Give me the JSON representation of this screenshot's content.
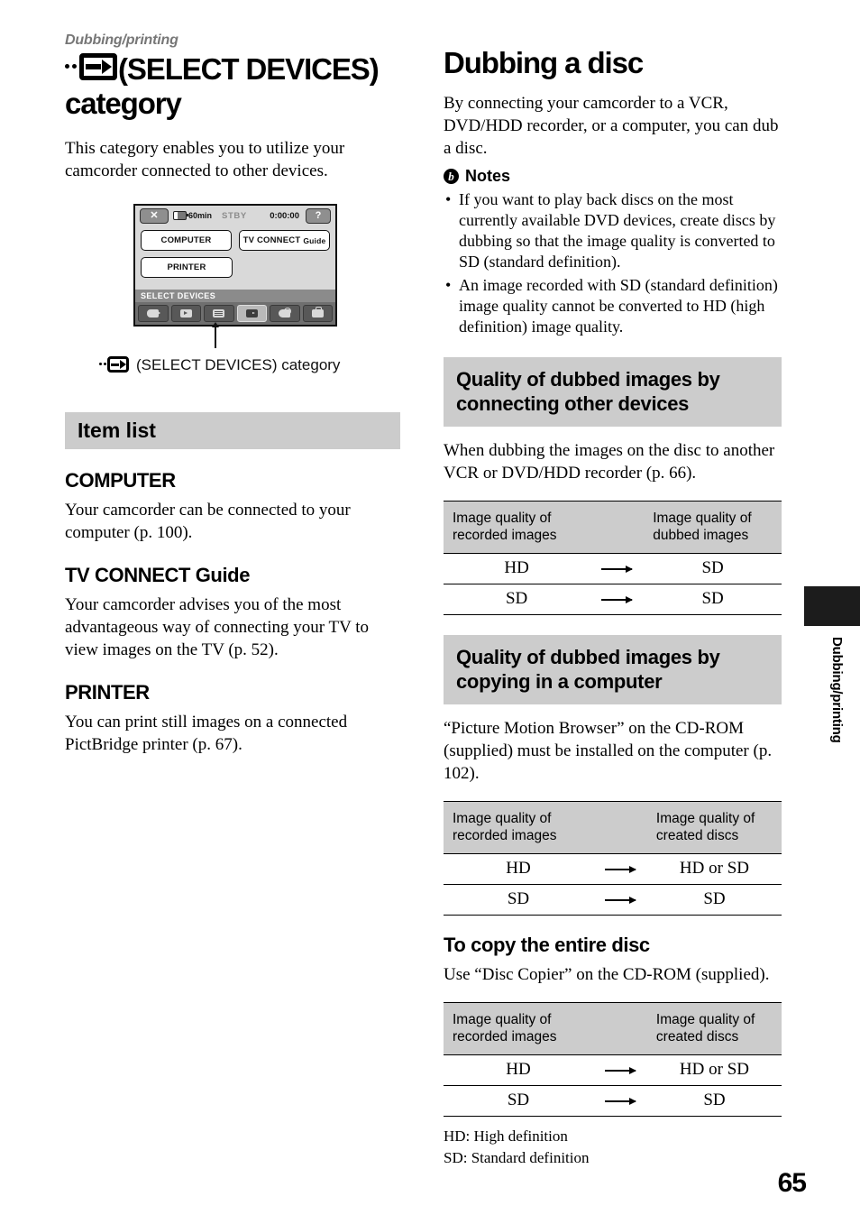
{
  "running_head": "Dubbing/printing",
  "left": {
    "title_text": "(SELECT DEVICES) category",
    "title_icon": "select-devices-icon",
    "intro": "This category enables you to utilize your camcorder connected to other devices.",
    "lcd": {
      "status": {
        "close_label": "✕",
        "battery_label": "60min",
        "mode_label": "STBY",
        "timecode": "0:00:00",
        "help_label": "?"
      },
      "items": [
        {
          "label": "COMPUTER"
        },
        {
          "label": "TV CONNECT",
          "sub": "Guide"
        },
        {
          "label": "PRINTER"
        }
      ],
      "category_label": "SELECT DEVICES",
      "tabs": [
        {
          "name": "camera-tab",
          "glyph": "cam",
          "active": false
        },
        {
          "name": "view-images-tab",
          "glyph": "play",
          "active": false
        },
        {
          "name": "others-tab",
          "glyph": "grid",
          "active": false
        },
        {
          "name": "select-devices-tab",
          "glyph": "dev",
          "active": true
        },
        {
          "name": "edit-tab",
          "glyph": "edit",
          "active": false
        },
        {
          "name": "manage-media-tab",
          "glyph": "tool",
          "active": false
        }
      ]
    },
    "lcd_caption": "(SELECT DEVICES) category",
    "item_list_heading": "Item list",
    "items": [
      {
        "heading": "COMPUTER",
        "body": "Your camcorder can be connected to your computer (p. 100)."
      },
      {
        "heading": "TV CONNECT Guide",
        "body": "Your camcorder advises you of the most advantageous way of connecting your TV to view images on the TV (p. 52)."
      },
      {
        "heading": "PRINTER",
        "body": "You can print still images on a connected PictBridge printer (p. 67)."
      }
    ]
  },
  "right": {
    "title": "Dubbing a disc",
    "intro": "By connecting your camcorder to a VCR, DVD/HDD recorder, or a computer, you can dub a disc.",
    "notes_heading": "Notes",
    "notes_icon_glyph": "b",
    "notes": [
      "If you want to play back discs on the most currently available DVD devices, create discs by dubbing so that the image quality is converted to SD (standard definition).",
      "An image recorded with SD (standard definition) image quality cannot be converted to HD (high definition) image quality."
    ],
    "section1": {
      "heading": "Quality of dubbed images by connecting other devices",
      "body": "When dubbing the images on the disc to another VCR or DVD/HDD recorder (p. 66).",
      "table": {
        "col1_header": "Image quality of recorded images",
        "col2_header": "Image quality of dubbed images",
        "rows": [
          {
            "from": "HD",
            "arrow": "→",
            "to": "SD"
          },
          {
            "from": "SD",
            "arrow": "→",
            "to": "SD"
          }
        ]
      }
    },
    "section2": {
      "heading": "Quality of dubbed images by copying in a computer",
      "body": "“Picture Motion Browser” on the CD-ROM (supplied) must be installed on the computer (p. 102).",
      "table": {
        "col1_header": "Image quality of recorded images",
        "col2_header": "Image quality of created discs",
        "rows": [
          {
            "from": "HD",
            "arrow": "→",
            "to": "HD or SD"
          },
          {
            "from": "SD",
            "arrow": "→",
            "to": "SD"
          }
        ]
      }
    },
    "section3": {
      "heading": "To copy the entire disc",
      "body": "Use “Disc Copier” on the CD-ROM (supplied).",
      "table": {
        "col1_header": "Image quality of recorded images",
        "col2_header": "Image quality of created discs",
        "rows": [
          {
            "from": "HD",
            "arrow": "→",
            "to": "HD or SD"
          },
          {
            "from": "SD",
            "arrow": "→",
            "to": "SD"
          }
        ]
      }
    },
    "legend": [
      "HD: High definition",
      "SD: Standard definition"
    ]
  },
  "side_tab_label": "Dubbing/printing",
  "page_number": "65"
}
